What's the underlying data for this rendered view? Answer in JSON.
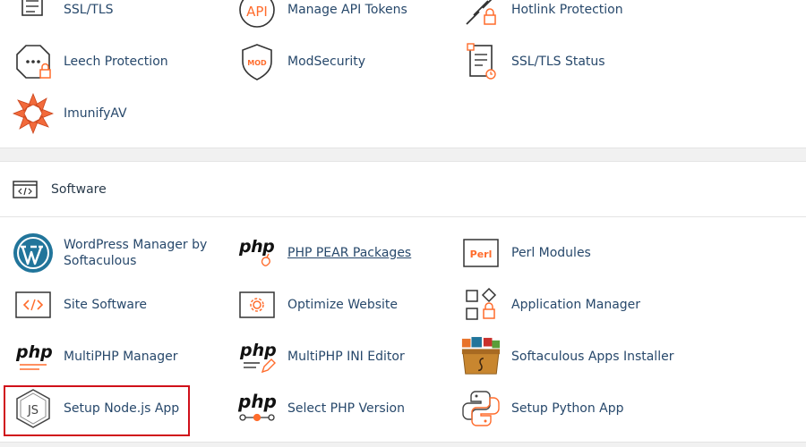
{
  "security": {
    "items": [
      {
        "label": "SSL/TLS",
        "icon": "ssl-tls-icon"
      },
      {
        "label": "Manage API Tokens",
        "icon": "api-icon"
      },
      {
        "label": "Hotlink Protection",
        "icon": "hotlink-icon"
      },
      {
        "label": "Leech Protection",
        "icon": "leech-icon"
      },
      {
        "label": "ModSecurity",
        "icon": "modsecurity-icon"
      },
      {
        "label": "SSL/TLS Status",
        "icon": "ssl-status-icon"
      },
      {
        "label": "ImunifyAV",
        "icon": "imunifyav-icon"
      }
    ],
    "api_text": "API",
    "mod_text": "MOD"
  },
  "software": {
    "title": "Software",
    "items": [
      {
        "label": "WordPress Manager by Softaculous",
        "icon": "wordpress-icon"
      },
      {
        "label": "PHP PEAR Packages",
        "icon": "php-pear-icon"
      },
      {
        "label": "Perl Modules",
        "icon": "perl-icon"
      },
      {
        "label": "Site Software",
        "icon": "code-icon"
      },
      {
        "label": "Optimize Website",
        "icon": "optimize-icon"
      },
      {
        "label": "Application Manager",
        "icon": "app-manager-icon"
      },
      {
        "label": "MultiPHP Manager",
        "icon": "multiphp-icon"
      },
      {
        "label": "MultiPHP INI Editor",
        "icon": "multiphp-ini-icon"
      },
      {
        "label": "Softaculous Apps Installer",
        "icon": "softaculous-icon"
      },
      {
        "label": "Setup Node.js App",
        "icon": "nodejs-icon"
      },
      {
        "label": "Select PHP Version",
        "icon": "php-version-icon"
      },
      {
        "label": "Setup Python App",
        "icon": "python-icon"
      }
    ],
    "php_text": "php",
    "perl_text": "Perl",
    "js_text": "JS"
  },
  "colors": {
    "accent": "#ff6c2c",
    "text": "#27486b",
    "highlight": "#d0101a"
  }
}
